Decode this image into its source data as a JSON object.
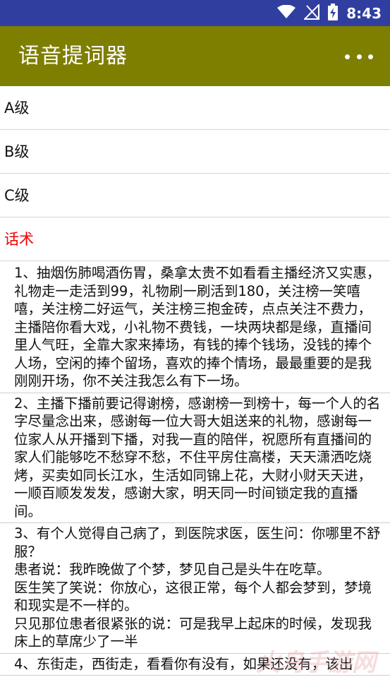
{
  "status_bar": {
    "time": "8:43",
    "icons": [
      "wifi-icon",
      "signal-no-sim-icon",
      "battery-charging-icon"
    ]
  },
  "app_bar": {
    "title": "语音提词器",
    "more_icon": "more-horizontal-icon"
  },
  "levels": [
    {
      "label": "A级",
      "active": false
    },
    {
      "label": "B级",
      "active": false
    },
    {
      "label": "C级",
      "active": false
    },
    {
      "label": "话术",
      "active": true
    }
  ],
  "scripts": [
    "1、抽烟伤肺喝酒伤胃，桑拿太贵不如看看主播经济又实惠，礼物走一走活到99，礼物刷一刷活到180，关注榜一笑嘻嘻，关注榜二好运气，关注榜三抱金砖，点点关注不费力，主播陪你看大戏，小礼物不费钱，一块两块都是缘，直播间里人气旺，全靠大家来捧场，有钱的捧个钱场，没钱的捧个人场，空闲的捧个留场，喜欢的捧个情场，最最重要的是我刚刚开场，你不关注我怎么有下一场。",
    "2、主播下播前要记得谢榜，感谢榜一到榜十，每一个人的名字尽量念出来，感谢每一位大哥大姐送来的礼物，感谢每一位家人从开播到下播，对我一直的陪伴，祝愿所有直播间的家人们能够吃不愁穿不愁，不住平房住高楼，天天潇洒吃烧烤，买卖如同长江水，生活如同锦上花，大财小财天天进，一顺百顺发发发，感谢大家，明天同一时间锁定我的直播间。",
    "3、有个人觉得自己病了，到医院求医，医生问：你哪里不舒服？\n患者说：我昨晚做了个梦，梦见自己是头牛在吃草。\n医生笑了笑说：你放心，这很正常，每个人都会梦到，梦境和现实是不一样的。\n只见那位患者很紧张的说：可是我早上起床的时候，发现我床上的草席少了一半",
    "4、东街走，西街走，看看你有没有，如果还没有，该出"
  ],
  "watermark": {
    "text": "火鸟手游网"
  }
}
